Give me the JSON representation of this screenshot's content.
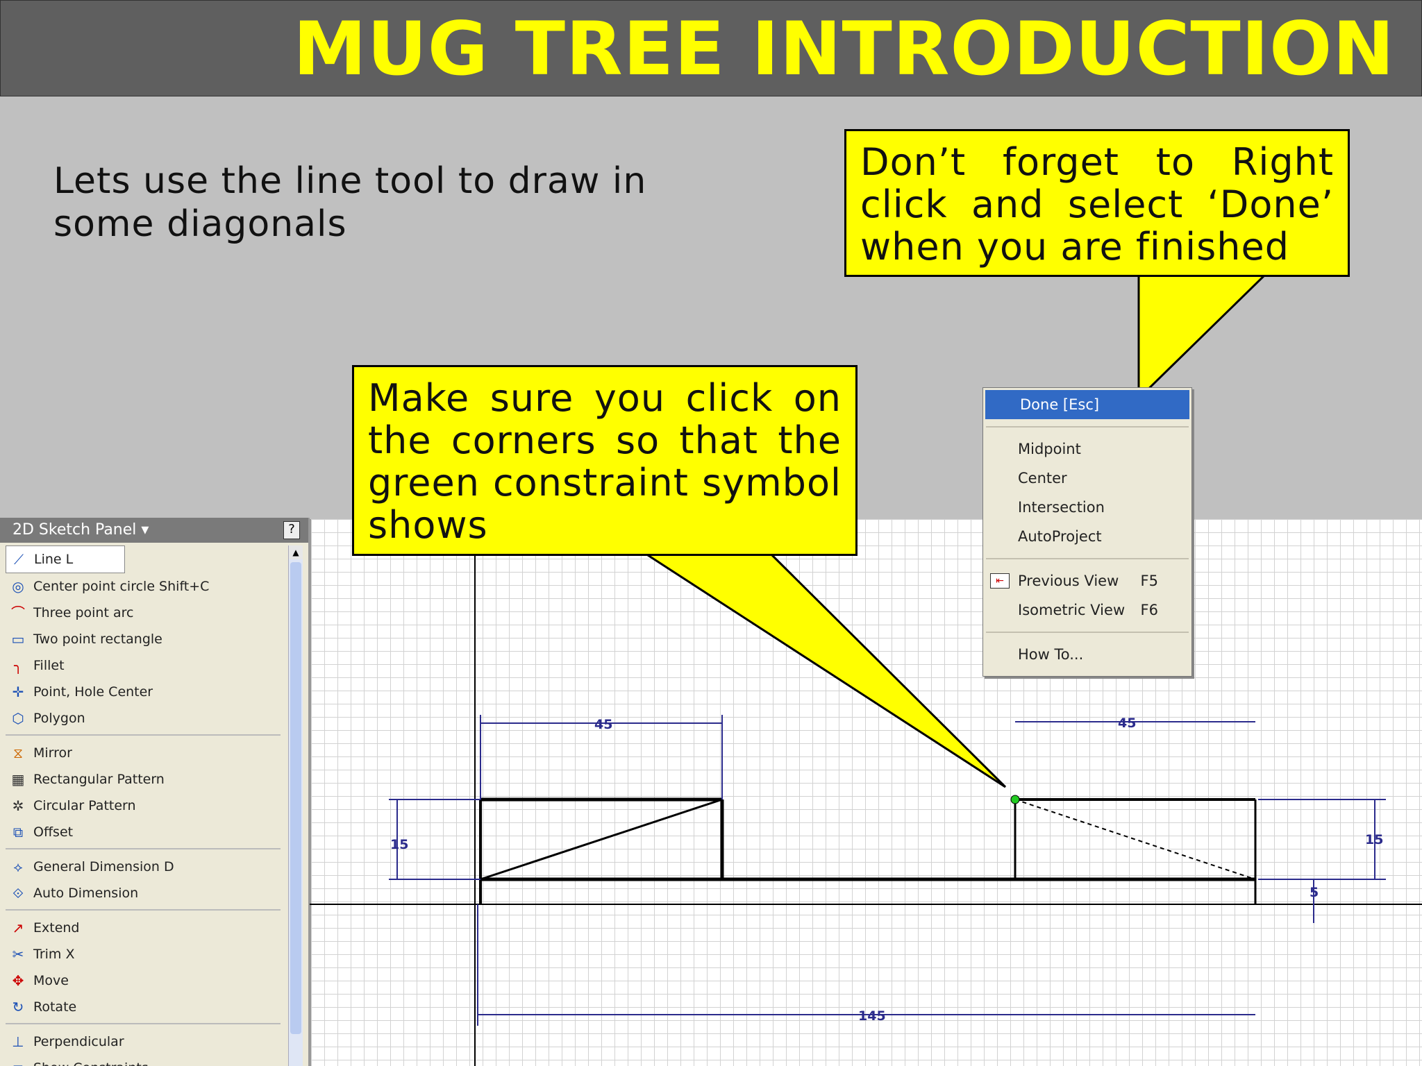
{
  "title": "MUG TREE INTRODUCTION",
  "intro_text": "Lets use the line tool to draw in some diagonals",
  "callouts": {
    "done": "Don’t forget to Right click and select ‘Done’ when you are finished",
    "corners": "Make sure you click on the corners so that the green constraint symbol shows"
  },
  "panel": {
    "header": "2D Sketch Panel",
    "help": "?",
    "tools": [
      {
        "label": "Line  L",
        "icon": "line-icon"
      },
      {
        "label": "Center point circle  Shift+C",
        "icon": "circle-icon"
      },
      {
        "label": "Three point arc",
        "icon": "arc-icon"
      },
      {
        "label": "Two point rectangle",
        "icon": "rectangle-icon"
      },
      {
        "label": "Fillet",
        "icon": "fillet-icon"
      },
      {
        "label": "Point, Hole Center",
        "icon": "point-icon"
      },
      {
        "label": "Polygon",
        "icon": "polygon-icon"
      },
      {
        "label": "Mirror",
        "icon": "mirror-icon"
      },
      {
        "label": "Rectangular Pattern",
        "icon": "rect-pattern-icon"
      },
      {
        "label": "Circular Pattern",
        "icon": "circ-pattern-icon"
      },
      {
        "label": "Offset",
        "icon": "offset-icon"
      },
      {
        "label": "General Dimension  D",
        "icon": "dimension-icon"
      },
      {
        "label": "Auto Dimension",
        "icon": "auto-dimension-icon"
      },
      {
        "label": "Extend",
        "icon": "extend-icon"
      },
      {
        "label": "Trim  X",
        "icon": "trim-icon"
      },
      {
        "label": "Move",
        "icon": "move-icon"
      },
      {
        "label": "Rotate",
        "icon": "rotate-icon"
      },
      {
        "label": "Perpendicular",
        "icon": "perpendicular-icon"
      },
      {
        "label": "Show Constraints",
        "icon": "constraints-icon"
      }
    ]
  },
  "context_menu": {
    "done": "Done   [Esc]",
    "midpoint": "Midpoint",
    "center": "Center",
    "intersection": "Intersection",
    "autoproject": "AutoProject",
    "previous_view": "Previous View",
    "previous_view_shortcut": "F5",
    "isometric_view": "Isometric View",
    "isometric_view_shortcut": "F6",
    "how_to": "How To..."
  },
  "dimensions": {
    "top_left": "45",
    "top_right": "45",
    "left_height": "15",
    "right_height": "15",
    "base": "5",
    "bottom": "145"
  },
  "colors": {
    "title_bg": "#5f5f5f",
    "title_text": "#ffff00",
    "callout_bg": "#ffff00",
    "menu_highlight": "#316ac5",
    "constraint_point": "#22cc22",
    "dimension": "#2b2b8c"
  }
}
